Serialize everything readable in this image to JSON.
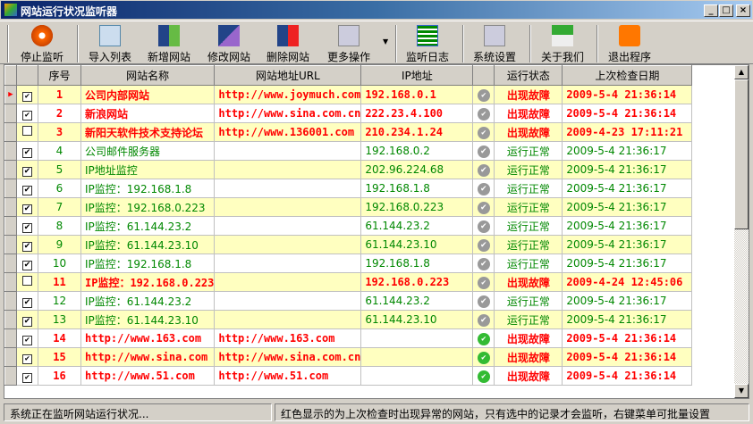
{
  "window": {
    "title": "网站运行状况监听器",
    "min": "_",
    "max": "□",
    "close": "×"
  },
  "toolbar": [
    {
      "label": "停止监听",
      "icon": "stop-icon"
    },
    {
      "label": "导入列表",
      "icon": "import-list-icon"
    },
    {
      "label": "新增网站",
      "icon": "add-site-icon"
    },
    {
      "label": "修改网站",
      "icon": "edit-site-icon"
    },
    {
      "label": "删除网站",
      "icon": "delete-site-icon"
    },
    {
      "label": "更多操作",
      "icon": "more-actions-icon"
    },
    {
      "label": "监听日志",
      "icon": "log-icon"
    },
    {
      "label": "系统设置",
      "icon": "settings-icon"
    },
    {
      "label": "关于我们",
      "icon": "home-icon"
    },
    {
      "label": "退出程序",
      "icon": "exit-icon"
    }
  ],
  "columns": [
    "序号",
    "网站名称",
    "网站地址URL",
    "IP地址",
    "",
    "运行状态",
    "上次检查日期"
  ],
  "rows": [
    {
      "checked": true,
      "no": "1",
      "name": "公司内部网站",
      "url": "http://www.joymuch.com",
      "ip": "192.168.0.1",
      "status": "出现故障",
      "date": "2009-5-4 21:36:14",
      "err": true,
      "icon": "gray"
    },
    {
      "checked": true,
      "no": "2",
      "name": "新浪网站",
      "url": "http://www.sina.com.cn",
      "ip": "222.23.4.100",
      "status": "出现故障",
      "date": "2009-5-4 21:36:14",
      "err": true,
      "icon": "gray"
    },
    {
      "checked": false,
      "no": "3",
      "name": "新阳天软件技术支持论坛",
      "url": "http://www.136001.com",
      "ip": "210.234.1.24",
      "status": "出现故障",
      "date": "2009-4-23 17:11:21",
      "err": true,
      "icon": "gray"
    },
    {
      "checked": true,
      "no": "4",
      "name": "公司邮件服务器",
      "url": "",
      "ip": "192.168.0.2",
      "status": "运行正常",
      "date": "2009-5-4 21:36:17",
      "err": false,
      "icon": "gray"
    },
    {
      "checked": true,
      "no": "5",
      "name": "IP地址监控",
      "url": "",
      "ip": "202.96.224.68",
      "status": "运行正常",
      "date": "2009-5-4 21:36:17",
      "err": false,
      "icon": "gray"
    },
    {
      "checked": true,
      "no": "6",
      "name": "IP监控：192.168.1.8",
      "url": "",
      "ip": "192.168.1.8",
      "status": "运行正常",
      "date": "2009-5-4 21:36:17",
      "err": false,
      "icon": "gray"
    },
    {
      "checked": true,
      "no": "7",
      "name": "IP监控：192.168.0.223",
      "url": "",
      "ip": "192.168.0.223",
      "status": "运行正常",
      "date": "2009-5-4 21:36:17",
      "err": false,
      "icon": "gray"
    },
    {
      "checked": true,
      "no": "8",
      "name": "IP监控：61.144.23.2",
      "url": "",
      "ip": "61.144.23.2",
      "status": "运行正常",
      "date": "2009-5-4 21:36:17",
      "err": false,
      "icon": "gray"
    },
    {
      "checked": true,
      "no": "9",
      "name": "IP监控：61.144.23.10",
      "url": "",
      "ip": "61.144.23.10",
      "status": "运行正常",
      "date": "2009-5-4 21:36:17",
      "err": false,
      "icon": "gray"
    },
    {
      "checked": true,
      "no": "10",
      "name": "IP监控：192.168.1.8",
      "url": "",
      "ip": "192.168.1.8",
      "status": "运行正常",
      "date": "2009-5-4 21:36:17",
      "err": false,
      "icon": "gray"
    },
    {
      "checked": false,
      "no": "11",
      "name": "IP监控：192.168.0.223",
      "url": "",
      "ip": "192.168.0.223",
      "status": "出现故障",
      "date": "2009-4-24 12:45:06",
      "err": true,
      "icon": "gray"
    },
    {
      "checked": true,
      "no": "12",
      "name": "IP监控：61.144.23.2",
      "url": "",
      "ip": "61.144.23.2",
      "status": "运行正常",
      "date": "2009-5-4 21:36:17",
      "err": false,
      "icon": "gray"
    },
    {
      "checked": true,
      "no": "13",
      "name": "IP监控：61.144.23.10",
      "url": "",
      "ip": "61.144.23.10",
      "status": "运行正常",
      "date": "2009-5-4 21:36:17",
      "err": false,
      "icon": "gray"
    },
    {
      "checked": true,
      "no": "14",
      "name": "http://www.163.com",
      "url": "http://www.163.com",
      "ip": "",
      "status": "出现故障",
      "date": "2009-5-4 21:36:14",
      "err": true,
      "icon": "green"
    },
    {
      "checked": true,
      "no": "15",
      "name": "http://www.sina.com",
      "url": "http://www.sina.com.cn",
      "ip": "",
      "status": "出现故障",
      "date": "2009-5-4 21:36:14",
      "err": true,
      "icon": "green"
    },
    {
      "checked": true,
      "no": "16",
      "name": "http://www.51.com",
      "url": "http://www.51.com",
      "ip": "",
      "status": "出现故障",
      "date": "2009-5-4 21:36:14",
      "err": true,
      "icon": "green"
    }
  ],
  "status": {
    "left": "系统正在监听网站运行状况...",
    "right": "红色显示的为上次检查时出现异常的网站，只有选中的记录才会监听，右键菜单可批量设置"
  }
}
